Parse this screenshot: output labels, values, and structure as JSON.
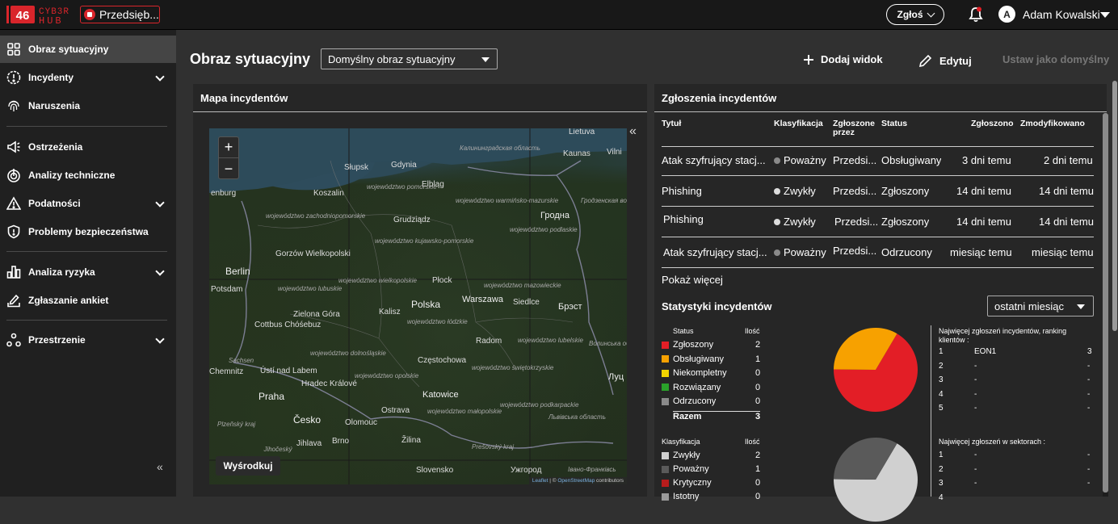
{
  "brand": {
    "logo_number": "46",
    "logo_text_top": "CYB3R",
    "logo_text_bottom": "HUB",
    "accent": "#d9252b"
  },
  "org_button": {
    "label": "Przedsięb..."
  },
  "topbar": {
    "report_button": "Zgłoś",
    "user_initial": "A",
    "user_name": "Adam Kowalski"
  },
  "sidebar": {
    "items": [
      {
        "label": "Obraz sytuacyjny",
        "icon": "dashboard-icon",
        "active": true
      },
      {
        "label": "Incydenty",
        "icon": "alert-circle-icon",
        "expandable": true
      },
      {
        "label": "Naruszenia",
        "icon": "fingerprint-icon"
      },
      {
        "label": "Ostrzeżenia",
        "icon": "megaphone-icon"
      },
      {
        "label": "Analizy techniczne",
        "icon": "radar-icon"
      },
      {
        "label": "Podatności",
        "icon": "warning-triangle-icon",
        "expandable": true
      },
      {
        "label": "Problemy bezpieczeństwa",
        "icon": "shield-icon"
      },
      {
        "label": "Analiza ryzyka",
        "icon": "bar-chart-icon",
        "expandable": true
      },
      {
        "label": "Zgłaszanie ankiet",
        "icon": "survey-icon"
      },
      {
        "label": "Przestrzenie",
        "icon": "spaces-icon",
        "expandable": true
      }
    ],
    "collapse_glyph": "«"
  },
  "header": {
    "title": "Obraz sytuacyjny",
    "view_select": "Domyślny obraz sytuacyjny",
    "add_view": "Dodaj widok",
    "edit": "Edytuj",
    "set_default": "Ustaw jako domyślny"
  },
  "map_panel": {
    "title": "Mapa incydentów",
    "zoom_in": "+",
    "zoom_out": "−",
    "center_button": "Wyśrodkuj",
    "attribution_link1": "Leaflet",
    "attribution_sep": " | © ",
    "attribution_link2": "OpenStreetMap",
    "attribution_tail": " contributors",
    "collapse_glyph": "«",
    "labels": {
      "lietuva": "Lietuva",
      "kaunas": "Kaunas",
      "vilnius": "Vilni",
      "kaliningrad": "Калининградская область",
      "slupsk": "Słupsk",
      "gdynia": "Gdynia",
      "elblag": "Elbląg",
      "koszalin": "Koszalin",
      "pomorskie": "województwo pomorskie",
      "zachpom": "województwo zachodniopomorskie",
      "warmaz": "województwo warmińsko-mazurskie",
      "grudziadz": "Grudziądz",
      "grodno": "Гродна",
      "grodno_obl": "Гродзенская вобласць",
      "podlaskie": "województwo podlaskie",
      "kujpom": "województwo kujawsko-pomorskie",
      "gorzow": "Gorzów Wielkopolski",
      "berlin": "Berlin",
      "denburg": "enburg",
      "potsdam": "Potsdam",
      "wielkopolskie": "województwo wielkopolskie",
      "plock": "Płock",
      "mazowieckie": "województwo mazowieckie",
      "lubuskie": "województwo lubuskie",
      "polska": "Polska",
      "warszawa": "Warszawa",
      "siedlce": "Siedlce",
      "brest": "Брэст",
      "zielona": "Zielona Góra",
      "kalisz": "Kalisz",
      "lodzkie": "województwo łódzkie",
      "cottbus": "Cottbus Chóśebuz",
      "radom": "Radom",
      "lubelskie": "województwo lubelskie",
      "volyn": "Волинська область",
      "sachsen": "Sachsen",
      "chemnitz": "Chemnitz",
      "usti": "Ústí nad Labem",
      "hradec": "Hradec Králové",
      "dolnoslaskie": "województwo dolnośląskie",
      "czestochowa": "Częstochowa",
      "opolskie": "województwo opolskie",
      "swietokrzyskie": "województwo świętokrzyskie",
      "podkarpackie": "województwo podkarpackie",
      "katowice": "Katowice",
      "praha": "Praha",
      "lutsk": "Луц",
      "cesko": "Česko",
      "ostrava": "Ostrava",
      "olomouc": "Olomouc",
      "malopolskie": "województwo małopolskie",
      "lviv": "Львівська область",
      "plzen": "Plzeňský kraj",
      "jihlava": "Jihlava",
      "jihocesky": "Jihočeský",
      "brno": "Brno",
      "zilina": "Žilina",
      "presov": "Prešovský kraj",
      "slovensko": "Slovensko",
      "uzhgorod": "Ужгород",
      "ivano": "Івано-Франківсь"
    }
  },
  "incidents_panel": {
    "title": "Zgłoszenia incydentów",
    "columns": [
      "Tytuł",
      "Klasyfikacja",
      "Zgłoszone przez",
      "Status",
      "Zgłoszono",
      "Zmodyfikowano"
    ],
    "rows": [
      {
        "title": "Atak szyfrujący stacj...",
        "classification": "Poważny",
        "class_color": "#8a8a8a",
        "reporter": "Przedsi...",
        "status": "Obsługiwany",
        "reported": "3 dni temu",
        "modified": "2 dni temu"
      },
      {
        "title": "Phishing",
        "classification": "Zwykły",
        "class_color": "#dddddd",
        "reporter": "Przedsi...",
        "status": "Zgłoszony",
        "reported": "14 dni temu",
        "modified": "14 dni temu"
      },
      {
        "title": "Phishing",
        "classification": "Zwykły",
        "class_color": "#dddddd",
        "reporter": "Przedsi...",
        "status": "Zgłoszony",
        "reported": "14 dni temu",
        "modified": "14 dni temu"
      },
      {
        "title": "Atak szyfrujący stacj...",
        "classification": "Poważny",
        "class_color": "#8a8a8a",
        "reporter": "Przedsi...",
        "status": "Odrzucony",
        "reported": "miesiąc temu",
        "modified": "miesiąc temu"
      }
    ],
    "show_more": "Pokaż więcej",
    "stats_title": "Statystyki incydentów",
    "period_select": "ostatni miesiąc",
    "status_table": {
      "header_status": "Status",
      "header_count": "Ilość",
      "rows": [
        {
          "label": "Zgłoszony",
          "value": 2,
          "color": "#e31e26"
        },
        {
          "label": "Obsługiwany",
          "value": 1,
          "color": "#f7a100"
        },
        {
          "label": "Niekompletny",
          "value": 0,
          "color": "#f2d400"
        },
        {
          "label": "Rozwiązany",
          "value": 0,
          "color": "#2aa12a"
        },
        {
          "label": "Odrzucony",
          "value": 0,
          "color": "#8a8a8a"
        }
      ],
      "total_label": "Razem",
      "total_value": 3
    },
    "class_table": {
      "header_class": "Klasyfikacja",
      "header_count": "Ilość",
      "rows": [
        {
          "label": "Zwykły",
          "value": 2,
          "color": "#d0d0d0"
        },
        {
          "label": "Poważny",
          "value": 1,
          "color": "#5a5a5a"
        },
        {
          "label": "Krytyczny",
          "value": 0,
          "color": "#b71c1c"
        },
        {
          "label": "Istotny",
          "value": 0,
          "color": "#9a9a9a"
        }
      ]
    },
    "ranking_clients": {
      "title": "Najwięcej zgłoszeń incydentów, ranking klientów :",
      "rows": [
        {
          "rank": "1",
          "name": "EON1",
          "value": "3"
        },
        {
          "rank": "2",
          "name": "-",
          "value": "-"
        },
        {
          "rank": "3",
          "name": "-",
          "value": "-"
        },
        {
          "rank": "4",
          "name": "-",
          "value": "-"
        },
        {
          "rank": "5",
          "name": "-",
          "value": "-"
        }
      ]
    },
    "ranking_sectors": {
      "title": "Najwięcej zgłoszeń w sektorach :",
      "rows": [
        {
          "rank": "1",
          "name": "-",
          "value": "-"
        },
        {
          "rank": "2",
          "name": "-",
          "value": "-"
        },
        {
          "rank": "3",
          "name": "-",
          "value": "-"
        },
        {
          "rank": "4",
          "name": "",
          "value": ""
        }
      ]
    }
  },
  "chart_data": [
    {
      "type": "pie",
      "categories": [
        "Zgłoszony",
        "Obsługiwany",
        "Niekompletny",
        "Rozwiązany",
        "Odrzucony"
      ],
      "values": [
        2,
        1,
        0,
        0,
        0
      ],
      "colors": [
        "#e31e26",
        "#f7a100",
        "#f2d400",
        "#2aa12a",
        "#8a8a8a"
      ]
    },
    {
      "type": "pie",
      "categories": [
        "Zwykły",
        "Poważny",
        "Krytyczny",
        "Istotny"
      ],
      "values": [
        2,
        1,
        0,
        0
      ],
      "colors": [
        "#d0d0d0",
        "#5a5a5a",
        "#b71c1c",
        "#9a9a9a"
      ]
    }
  ]
}
